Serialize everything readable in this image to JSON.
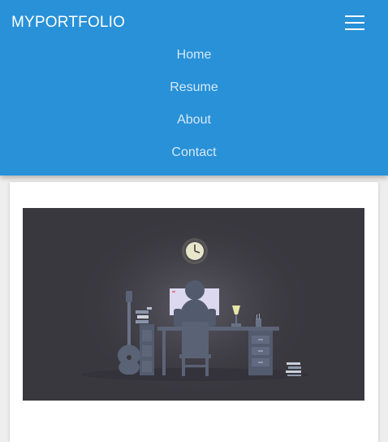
{
  "navbar": {
    "brand": "MYPORTFOLIO",
    "menu_icon": "hamburger-menu-icon",
    "links": [
      {
        "label": "Home"
      },
      {
        "label": "Resume"
      },
      {
        "label": "About"
      },
      {
        "label": "Contact"
      }
    ]
  },
  "hero": {
    "illustration": "person-working-at-desk-illustration",
    "icons": [
      "wall-clock-icon",
      "guitar-icon",
      "desk-lamp-icon",
      "book-stack-icon"
    ]
  },
  "colors": {
    "navbar_bg": "#2891d8",
    "nav_link": "#d6e8f6",
    "hero_bg": "#3a383f"
  }
}
